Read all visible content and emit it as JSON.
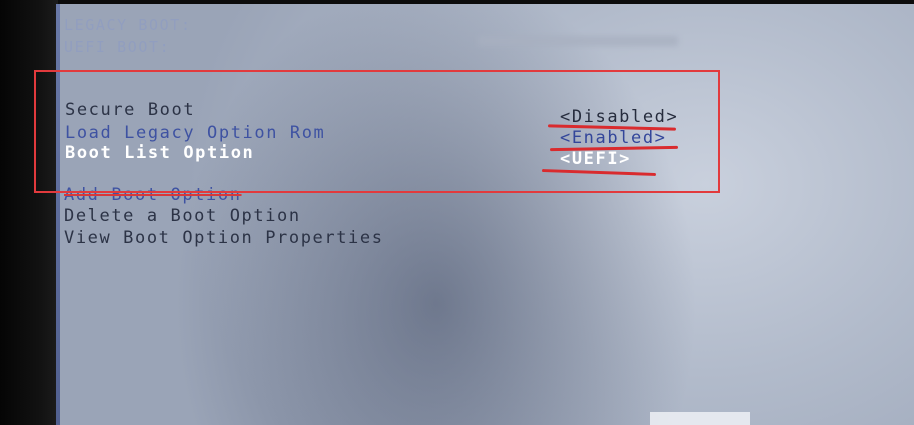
{
  "bios": {
    "header_lines": {
      "legacy_boot": "LEGACY BOOT:",
      "uefi_boot": "UEFI BOOT:"
    },
    "settings": [
      {
        "label": "Secure Boot",
        "value": "<Disabled>"
      },
      {
        "label": "Load Legacy Option Rom",
        "value": "<Enabled>"
      },
      {
        "label": "Boot List Option",
        "value": "<UEFI>"
      }
    ],
    "actions": [
      {
        "label": "Add Boot Option"
      },
      {
        "label": "Delete a Boot Option"
      },
      {
        "label": "View Boot Option Properties"
      }
    ]
  },
  "annotation": {
    "box_color": "#e23a3d",
    "underline_color": "#d92b2e"
  },
  "colors": {
    "screen_bg": "#b2bbcb",
    "normal_text": "#2c3346",
    "highlight_blue": "#3e52a2",
    "selected_text": "#ffffff"
  }
}
